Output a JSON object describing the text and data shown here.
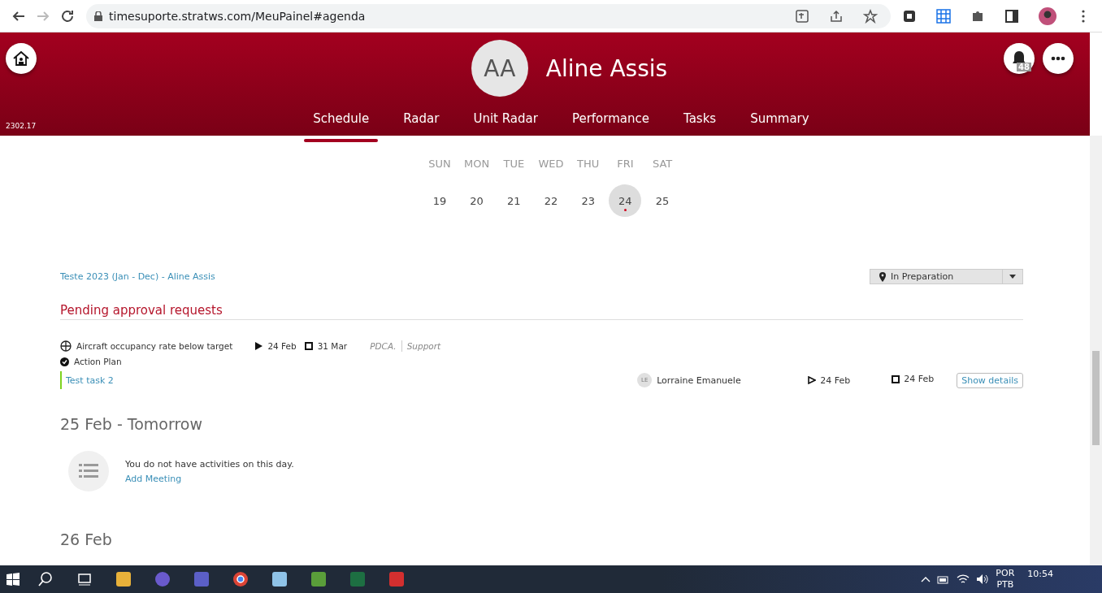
{
  "browser": {
    "url": "timesuporte.stratws.com/MeuPainel#agenda"
  },
  "header": {
    "avatar_initials": "AA",
    "user_name": "Aline Assis",
    "version": "2302.17",
    "notification_count": "48"
  },
  "nav_tabs": [
    {
      "label": "Schedule",
      "selected": true
    },
    {
      "label": "Radar",
      "selected": false
    },
    {
      "label": "Unit Radar",
      "selected": false
    },
    {
      "label": "Performance",
      "selected": false
    },
    {
      "label": "Tasks",
      "selected": false
    },
    {
      "label": "Summary",
      "selected": false
    }
  ],
  "week": [
    {
      "day": "SUN",
      "date": "19",
      "selected": false,
      "has_event": false
    },
    {
      "day": "MON",
      "date": "20",
      "selected": false,
      "has_event": false
    },
    {
      "day": "TUE",
      "date": "21",
      "selected": false,
      "has_event": false
    },
    {
      "day": "WED",
      "date": "22",
      "selected": false,
      "has_event": false
    },
    {
      "day": "THU",
      "date": "23",
      "selected": false,
      "has_event": false
    },
    {
      "day": "FRI",
      "date": "24",
      "selected": true,
      "has_event": true
    },
    {
      "day": "SAT",
      "date": "25",
      "selected": false,
      "has_event": false
    }
  ],
  "agenda": {
    "goal_link": "Teste 2023 (Jan - Dec) - Aline Assis",
    "status_dropdown": "In Preparation",
    "section_title": "Pending approval requests",
    "request": {
      "title": "Aircraft occupancy rate below target",
      "start": "24 Feb",
      "end": "31 Mar",
      "method": "PDCA.",
      "area": "Support",
      "type": "Action Plan"
    },
    "task": {
      "name": "Test task 2",
      "assignee_initials": "LE",
      "assignee": "Lorraine Emanuele",
      "start": "24 Feb",
      "end": "24 Feb",
      "button": "Show details"
    }
  },
  "days": [
    {
      "title": "25 Feb - Tomorrow",
      "empty_text": "You do not have activities on this day.",
      "add_link": "Add Meeting"
    },
    {
      "title": "26 Feb"
    }
  ],
  "taskbar": {
    "language": "POR",
    "layout": "PTB",
    "time": "10:54"
  }
}
